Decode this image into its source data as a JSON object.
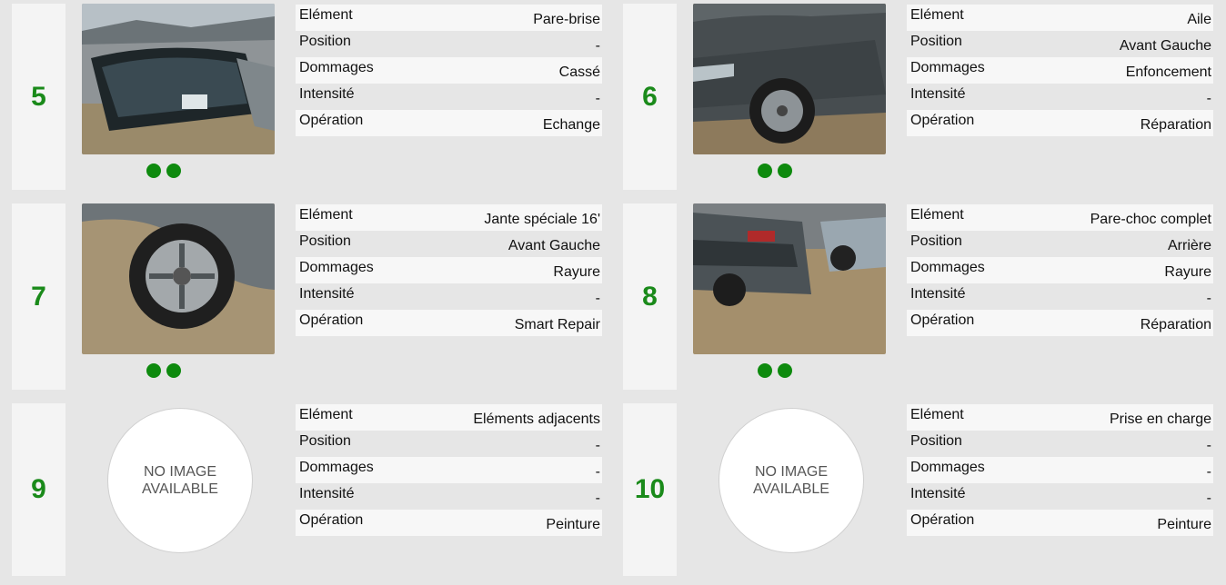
{
  "labels": {
    "element": "Elément",
    "position": "Position",
    "dommages": "Dommages",
    "intensite": "Intensité",
    "operation": "Opération"
  },
  "no_image": {
    "line1": "NO IMAGE",
    "line2": "AVAILABLE"
  },
  "colors": {
    "number": "#1a8a1a",
    "dot": "#0e8a0e"
  },
  "cards": [
    {
      "number": "5",
      "photo": "windshield-photo",
      "thumbnails": 2,
      "element": "Pare-brise",
      "position": "-",
      "dommages": "Cassé",
      "intensite": "-",
      "operation": "Echange"
    },
    {
      "number": "6",
      "photo": "front-wing-photo",
      "thumbnails": 2,
      "element": "Aile",
      "position": "Avant Gauche",
      "dommages": "Enfoncement",
      "intensite": "-",
      "operation": "Réparation"
    },
    {
      "number": "7",
      "photo": "wheel-rim-photo",
      "thumbnails": 2,
      "element": "Jante spéciale 16'",
      "position": "Avant Gauche",
      "dommages": "Rayure",
      "intensite": "-",
      "operation": "Smart Repair"
    },
    {
      "number": "8",
      "photo": "rear-bumper-photo",
      "thumbnails": 2,
      "element": "Pare-choc complet",
      "position": "Arrière",
      "dommages": "Rayure",
      "intensite": "-",
      "operation": "Réparation"
    },
    {
      "number": "9",
      "photo": "no-image",
      "thumbnails": 0,
      "element": "Eléments adjacents",
      "position": "-",
      "dommages": "-",
      "intensite": "-",
      "operation": "Peinture"
    },
    {
      "number": "10",
      "photo": "no-image",
      "thumbnails": 0,
      "element": "Prise en charge",
      "position": "-",
      "dommages": "-",
      "intensite": "-",
      "operation": "Peinture"
    }
  ]
}
